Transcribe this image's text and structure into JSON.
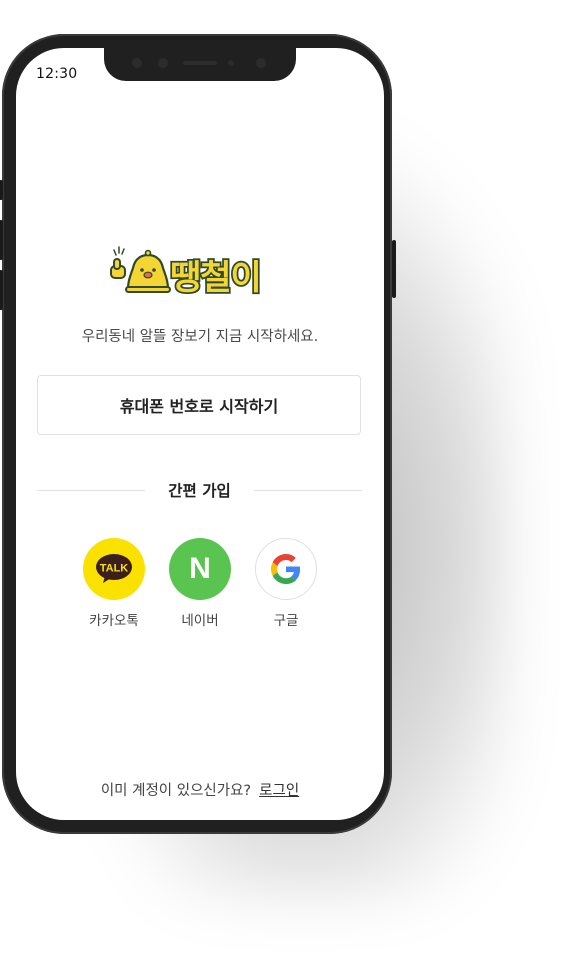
{
  "status_bar": {
    "time": "12:30"
  },
  "brand": {
    "logo_text": "땡철이",
    "tagline": "우리동네 알뜰 장보기 지금 시작하세요."
  },
  "auth": {
    "phone_button_label": "휴대폰 번호로 시작하기",
    "divider_label": "간편 가입",
    "social": [
      {
        "label": "카카오톡",
        "icon": "kakaotalk-icon",
        "icon_text": "TALK",
        "bg": "#fae100"
      },
      {
        "label": "네이버",
        "icon": "naver-icon",
        "icon_text": "N",
        "bg": "#5ac451"
      },
      {
        "label": "구글",
        "icon": "google-icon",
        "icon_text": "G",
        "bg": "#ffffff"
      }
    ]
  },
  "footer": {
    "question": "이미 계정이 있으신가요?",
    "login_link": "로그인"
  },
  "colors": {
    "phone_frame": "#202020",
    "brand_yellow": "#f5d533",
    "brand_dark": "#2f4a2b"
  }
}
